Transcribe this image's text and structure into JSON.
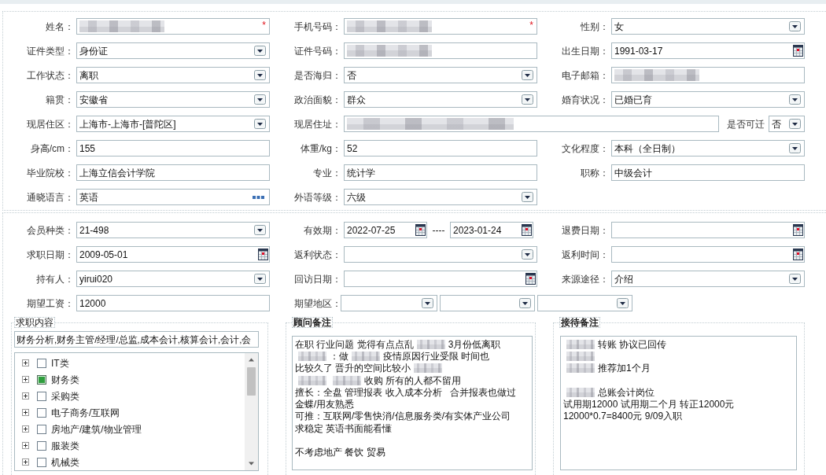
{
  "profile_section": {
    "rows": [
      {
        "fields": [
          {
            "label": "姓名：",
            "kind": "redacted",
            "required_mark": "*"
          },
          {
            "label": "手机号码：",
            "kind": "redacted",
            "required_mark": "*"
          },
          {
            "label": "性别：",
            "kind": "select",
            "value": "女"
          }
        ]
      },
      {
        "fields": [
          {
            "label": "证件类型：",
            "kind": "select",
            "value": "身份证"
          },
          {
            "label": "证件号码：",
            "kind": "redacted"
          },
          {
            "label": "出生日期：",
            "kind": "date",
            "value": "1991-03-17"
          }
        ]
      },
      {
        "fields": [
          {
            "label": "工作状态：",
            "kind": "select",
            "value": "离职"
          },
          {
            "label": "是否海归：",
            "kind": "select",
            "value": "否"
          },
          {
            "label": "电子邮箱：",
            "kind": "redacted"
          }
        ]
      },
      {
        "fields": [
          {
            "label": "籍贯：",
            "kind": "select",
            "value": "安徽省"
          },
          {
            "label": "政治面貌：",
            "kind": "select",
            "value": "群众"
          },
          {
            "label": "婚育状况：",
            "kind": "select",
            "value": "已婚已育"
          }
        ]
      },
      {
        "fields": [
          {
            "label": "现居住区：",
            "kind": "select",
            "value": "上海市-上海市-[普陀区]"
          },
          {
            "label": "现居住址：",
            "kind": "redacted",
            "attached": {
              "label": "是否可迁",
              "kind": "select",
              "value": "否"
            }
          }
        ]
      },
      {
        "fields": [
          {
            "label": "身高/cm：",
            "kind": "text",
            "value": "155"
          },
          {
            "label": "体重/kg：",
            "kind": "text",
            "value": "52"
          },
          {
            "label": "文化程度：",
            "kind": "select",
            "value": "本科（全日制）"
          }
        ]
      },
      {
        "fields": [
          {
            "label": "毕业院校：",
            "kind": "text",
            "value": "上海立信会计学院"
          },
          {
            "label": "专业：",
            "kind": "text",
            "value": "统计学"
          },
          {
            "label": "职称：",
            "kind": "text",
            "value": "中级会计"
          }
        ]
      },
      {
        "fields": [
          {
            "label": "通晓语言：",
            "kind": "lookup",
            "value": "英语"
          },
          {
            "label": "外语等级：",
            "kind": "select",
            "value": "六级"
          }
        ]
      }
    ]
  },
  "membership_section": {
    "rows": [
      {
        "fields": [
          {
            "label": "会员种类：",
            "kind": "select",
            "value": "21-498"
          },
          {
            "label": "有效期：",
            "kind": "date_range",
            "values": [
              "2022-07-25",
              "2023-01-24"
            ],
            "separator": "----"
          },
          {
            "label": "退费日期：",
            "kind": "date"
          }
        ]
      },
      {
        "fields": [
          {
            "label": "求职日期：",
            "kind": "date",
            "value": "2009-05-01"
          },
          {
            "label": "返利状态：",
            "kind": "select"
          },
          {
            "label": "返利时间：",
            "kind": "date"
          }
        ]
      },
      {
        "fields": [
          {
            "label": "持有人：",
            "kind": "select",
            "value": "yirui020"
          },
          {
            "label": "回访日期：",
            "kind": "date"
          },
          {
            "label": "来源途径：",
            "kind": "select",
            "value": "介绍"
          }
        ]
      },
      {
        "fields": [
          {
            "label": "期望工资：",
            "kind": "text",
            "value": "12000"
          },
          {
            "label": "期望地区：",
            "kind": "select_group",
            "parts": [
              {
                "kind": "select"
              },
              {
                "kind": "select"
              },
              {
                "kind": "select"
              }
            ]
          }
        ]
      }
    ],
    "panels": [
      {
        "title": "求职内容",
        "kind": "checklist",
        "summary": "财务分析,财务主管/经理/总监,成本会计,核算会计,会计,会",
        "items": [
          {
            "label": "IT类",
            "expanded": false,
            "checked": false
          },
          {
            "label": "财务类",
            "expanded": false,
            "checked": true
          },
          {
            "label": "采购类",
            "expanded": false,
            "checked": false
          },
          {
            "label": "电子商务/互联网",
            "expanded": false,
            "checked": false
          },
          {
            "label": "房地产/建筑/物业管理",
            "expanded": false,
            "checked": false
          },
          {
            "label": "服装类",
            "expanded": false,
            "checked": false
          },
          {
            "label": "机械类",
            "expanded": false,
            "checked": false
          }
        ]
      },
      {
        "title": "顾问备注",
        "kind": "notes",
        "lines": [
          {
            "kind": "text",
            "parts": [
              {
                "kind": "text",
                "text": "在职 行业问题 觉得有点点乱"
              },
              {
                "kind": "redacted"
              },
              {
                "kind": "text",
                "text": "3月份低离职"
              }
            ]
          },
          {
            "kind": "text",
            "parts": [
              {
                "kind": "redacted"
              },
              {
                "kind": "text",
                "text": "：做"
              },
              {
                "kind": "redacted"
              },
              {
                "kind": "text",
                "text": "疫情原因行业受限 时间也"
              }
            ]
          },
          {
            "kind": "text",
            "parts": [
              {
                "kind": "text",
                "text": "比较久了 晋升的空间比较小"
              },
              {
                "kind": "redacted"
              }
            ]
          },
          {
            "kind": "text",
            "parts": [
              {
                "kind": "redacted"
              },
              {
                "kind": "redacted"
              },
              {
                "kind": "text",
                "text": "收购 所有的人都不留用"
              }
            ]
          },
          {
            "kind": "text",
            "parts": [
              {
                "kind": "text",
                "text": "擅长：全盘 管理报表 收入成本分析   合并报表也做过"
              }
            ]
          },
          {
            "kind": "text",
            "parts": [
              {
                "kind": "text",
                "text": "金蝶/用友熟悉"
              }
            ]
          },
          {
            "kind": "text",
            "parts": [
              {
                "kind": "text",
                "text": "可推：互联网/零售快消/信息服务类/有实体产业公司"
              }
            ]
          },
          {
            "kind": "text",
            "parts": [
              {
                "kind": "text",
                "text": "求稳定 英语书面能看懂"
              }
            ]
          },
          {
            "kind": "blank"
          },
          {
            "kind": "text",
            "parts": [
              {
                "kind": "text",
                "text": "不考虑地产 餐饮 贸易"
              }
            ]
          }
        ]
      },
      {
        "title": "接待备注",
        "kind": "notes",
        "lines": [
          {
            "kind": "text",
            "parts": [
              {
                "kind": "redacted"
              },
              {
                "kind": "text",
                "text": "转账 协议已回传"
              }
            ]
          },
          {
            "kind": "text",
            "parts": [
              {
                "kind": "redacted"
              }
            ]
          },
          {
            "kind": "text",
            "parts": [
              {
                "kind": "redacted"
              },
              {
                "kind": "text",
                "text": "推荐加1个月"
              }
            ]
          },
          {
            "kind": "blank"
          },
          {
            "kind": "text",
            "parts": [
              {
                "kind": "redacted"
              },
              {
                "kind": "text",
                "text": "总账会计岗位"
              }
            ]
          },
          {
            "kind": "text",
            "parts": [
              {
                "kind": "text",
                "text": "试用期12000 试用期二个月 转正12000元"
              }
            ]
          },
          {
            "kind": "text",
            "parts": [
              {
                "kind": "text",
                "text": "12000*0.7=8400元 9/09入职"
              }
            ]
          }
        ]
      }
    ]
  }
}
